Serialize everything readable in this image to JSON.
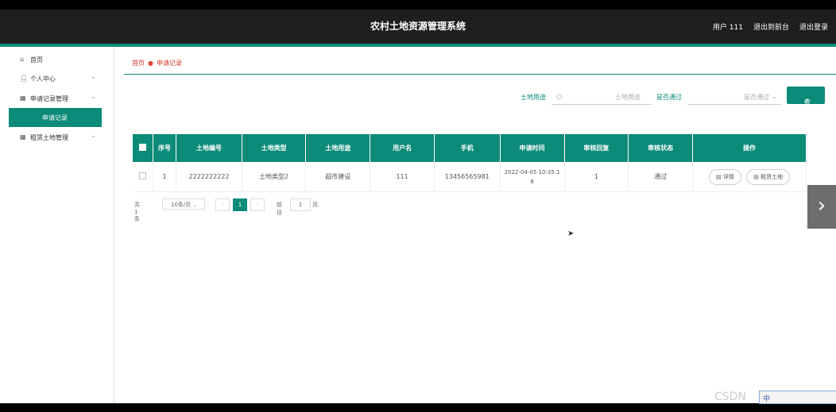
{
  "header": {
    "title": "农村土地资源管理系统",
    "user_label": "用户 111",
    "back_front": "退出到前台",
    "logout": "退出登录"
  },
  "sidebar": {
    "items": [
      {
        "label": "首页",
        "icon": "home-icon"
      },
      {
        "label": "个人中心",
        "icon": "user-icon"
      },
      {
        "label": "申请记录管理",
        "icon": "grid-icon"
      },
      {
        "label": "申请记录",
        "icon": ""
      },
      {
        "label": "租赁土地管理",
        "icon": "grid-icon"
      }
    ]
  },
  "breadcrumb": {
    "home": "首页",
    "current": "申请记录"
  },
  "search": {
    "land_use_label": "土地用途",
    "land_use_placeholder": "土地用途",
    "approved_label": "是否通过",
    "approved_placeholder": "是否通过",
    "search_button": "查询"
  },
  "table": {
    "headers": [
      "序号",
      "土地编号",
      "土地类型",
      "土地用途",
      "用户名",
      "手机",
      "申请时间",
      "审核回复",
      "审核状态",
      "操作"
    ],
    "rows": [
      {
        "index": "1",
        "land_no": "2222222222",
        "land_type": "土地类型2",
        "land_use": "超市建设",
        "username": "111",
        "phone": "13456565981",
        "apply_time_1": "2022-04-05 10:35:1",
        "apply_time_2": "8",
        "reply": "1",
        "status": "通过",
        "detail_btn": "详情",
        "lease_btn": "租赁土地"
      }
    ]
  },
  "pager": {
    "total": "共 1 条",
    "page_size": "10条/页",
    "current_page": "1",
    "goto_label": "前往",
    "goto_value": "1",
    "page_suffix": "页"
  },
  "watermark": {
    "text": "CSDN",
    "box": "中"
  },
  "colors": {
    "accent": "#0b8b78",
    "header_bg": "#1e1e1e",
    "breadcrumb": "#d43a2a"
  }
}
